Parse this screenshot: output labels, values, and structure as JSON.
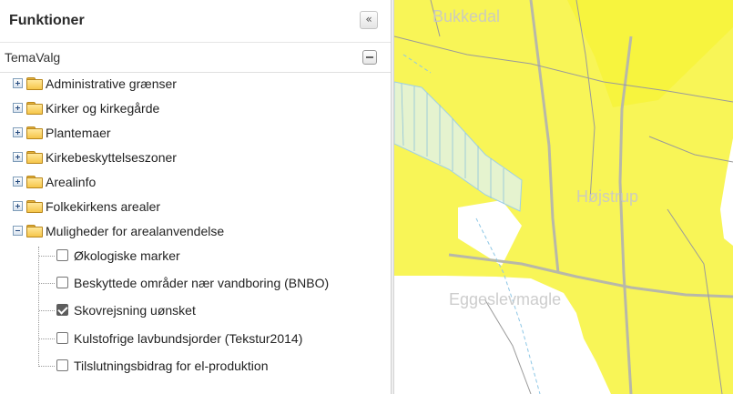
{
  "panel": {
    "title": "Funktioner",
    "collapse_icon": "double-chevron-left-icon",
    "collapse_glyph": "«"
  },
  "section": {
    "title": "TemaValg",
    "toggle_icon": "minus-icon"
  },
  "tree": {
    "folders": [
      {
        "label": "Administrative grænser",
        "expanded": false
      },
      {
        "label": "Kirker og kirkegårde",
        "expanded": false
      },
      {
        "label": "Plantemaer",
        "expanded": false
      },
      {
        "label": "Kirkebeskyttelseszoner",
        "expanded": false
      },
      {
        "label": "Arealinfo",
        "expanded": false
      },
      {
        "label": "Folkekirkens arealer",
        "expanded": false
      },
      {
        "label": "Muligheder for arealanvendelse",
        "expanded": true
      }
    ],
    "layers": [
      {
        "label": "Økologiske marker",
        "checked": false
      },
      {
        "label": "Beskyttede områder nær vandboring (BNBO)",
        "checked": false
      },
      {
        "label": "Skovrejsning uønsket",
        "checked": true
      },
      {
        "label": "Kulstofrige lavbundsjorder (Tekstur2014)",
        "checked": false
      },
      {
        "label": "Tilslutningsbidrag for el-produktion",
        "checked": false
      }
    ]
  },
  "map": {
    "place_labels": [
      "Bukkedal",
      "Højstrup",
      "Eggeslevmagle"
    ],
    "overlay_color": "#f7f33a",
    "background_color": "#ffffff"
  }
}
